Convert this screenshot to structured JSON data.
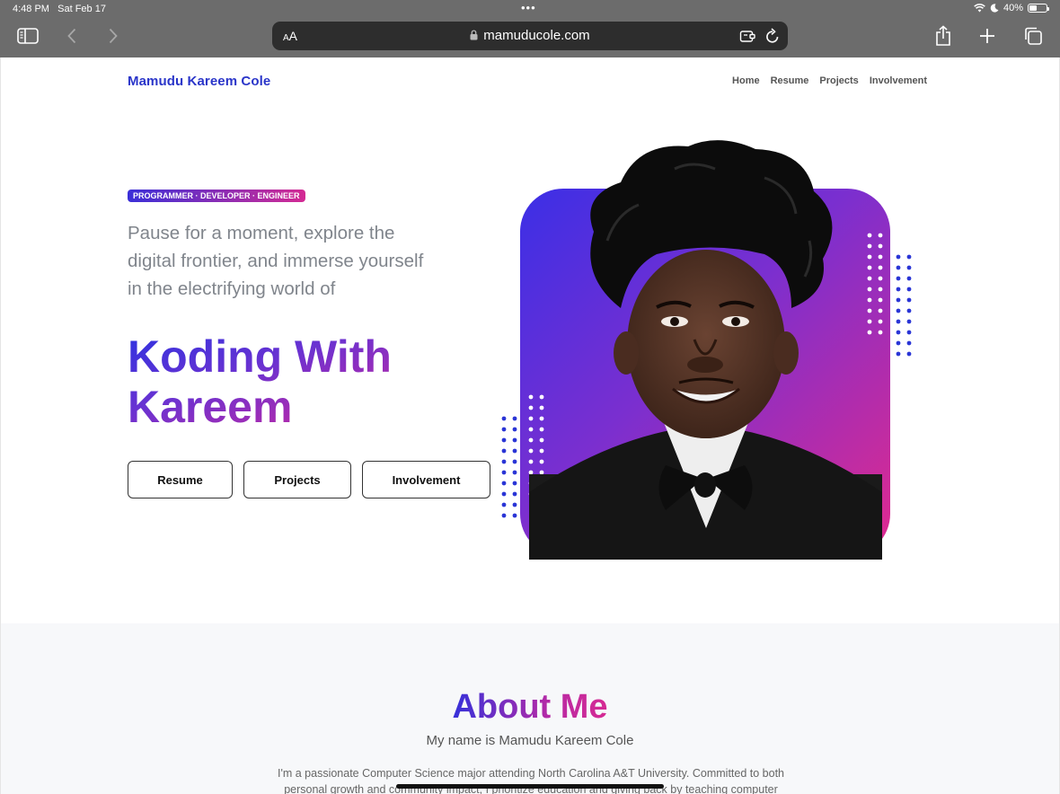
{
  "status": {
    "time": "4:48 PM",
    "date": "Sat Feb 17",
    "battery": "40%",
    "dots": "•••"
  },
  "browser": {
    "aa_small": "A",
    "aa_big": "A",
    "url": "mamuducole.com"
  },
  "site": {
    "brand": "Mamudu Kareem Cole",
    "nav": [
      "Home",
      "Resume",
      "Projects",
      "Involvement"
    ],
    "pill": "PROGRAMMER · DEVELOPER · ENGINEER",
    "tagline": "Pause for a moment, explore the digital frontier, and immerse yourself in the electrifying world of",
    "headline_line1": "Koding With",
    "headline_line2": "Kareem",
    "buttons": {
      "resume": "Resume",
      "projects": "Projects",
      "involvement": "Involvement"
    }
  },
  "about": {
    "title": "About Me",
    "subtitle": "My name is Mamudu Kareem Cole",
    "body": "I'm a passionate Computer Science major attending North Carolina A&T University. Committed to both personal growth and community impact, I prioritize education and giving back by teaching computer"
  },
  "colors": {
    "brand_blue": "#2a35c9",
    "gradient_start": "#2e32e0",
    "gradient_end": "#d42a93",
    "chrome_gray": "#6c6c6c"
  }
}
